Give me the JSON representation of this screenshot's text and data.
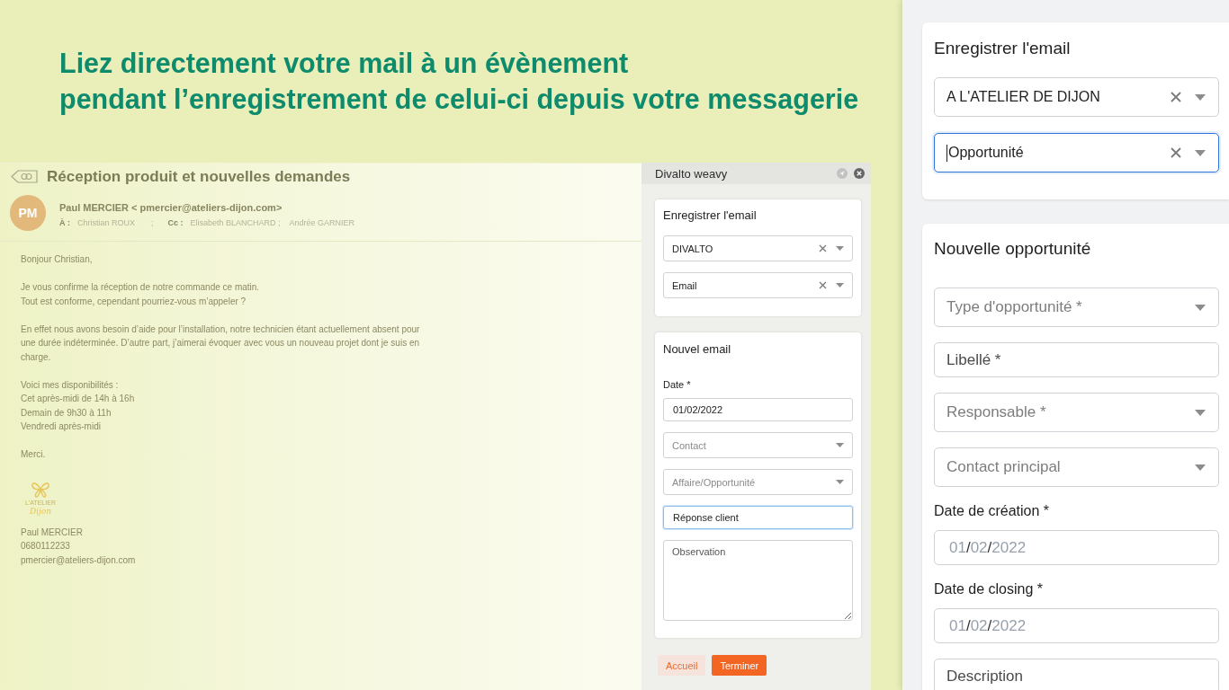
{
  "headline": [
    "Liez directement votre mail à un évènement",
    "pendant l’enregistrement de celui-ci depuis votre messagerie"
  ],
  "email": {
    "subject": "Réception produit et nouvelles demandes",
    "avatar_initials": "PM",
    "sender": "Paul MERCIER < pmercier@ateliers-dijon.com>",
    "recipients": [
      {
        "kind": "label",
        "text": "À :"
      },
      {
        "kind": "name",
        "text": "Christian ROUX"
      },
      {
        "kind": "separator",
        "text": ";"
      },
      {
        "kind": "label",
        "text": "Cc :"
      },
      {
        "kind": "name",
        "text": "Elisabeth BLANCHARD ;"
      },
      {
        "kind": "name",
        "text": "Andrée GARNIER"
      }
    ],
    "body": [
      [
        "Bonjour Christian,"
      ],
      [
        "Je vous confirme la réception de notre commande ce matin.",
        "Tout est conforme, cependant pourriez-vous m’appeler ?"
      ],
      [
        "En effet nous avons besoin d’aide pour l’installation, notre technicien étant actuellement absent pour une durée indéterminée. D’autre part, j’aimerai évoquer avec vous un nouveau projet dont je suis en charge."
      ],
      [
        "Voici mes disponibilités :",
        "Cet après-midi de 14h à 16h",
        "Demain de 9h30 à 11h",
        "Vendredi après-midi"
      ],
      [
        "Merci."
      ]
    ],
    "logo": {
      "name": "L'ATELIER",
      "script": "Dijon"
    },
    "signature": [
      "Paul MERCIER",
      "0680112233",
      "pmercier@ateliers-dijon.com"
    ]
  },
  "addin": {
    "title": "Divalto weavy",
    "cards": [
      {
        "title": "Enregistrer l'email",
        "fields": [
          {
            "kind": "select",
            "value": "DIVALTO",
            "focused": false
          },
          {
            "kind": "select",
            "value": "Email",
            "focused": false
          }
        ]
      },
      {
        "title": "Nouvel email",
        "fields": [
          {
            "kind": "input",
            "label": "Date *",
            "value": "01/02/2022",
            "focused": false
          },
          {
            "kind": "select",
            "placeholder": "Contact",
            "focused": false
          },
          {
            "kind": "select",
            "placeholder": "Affaire/Opportunité",
            "focused": false
          },
          {
            "kind": "input",
            "value": "Réponse client",
            "focused": true
          },
          {
            "kind": "textarea",
            "placeholder": "Observation",
            "focused": false
          }
        ]
      }
    ],
    "buttons": [
      {
        "kind": "secondary",
        "label": "Accueil"
      },
      {
        "kind": "primary",
        "label": "Terminer"
      }
    ]
  },
  "side_panel": {
    "cards": [
      {
        "title": "Enregistrer l'email",
        "fields": [
          {
            "kind": "select",
            "value": "A L'ATELIER DE DIJON",
            "focused": false
          },
          {
            "kind": "select",
            "value": "Opportunité",
            "focused": true
          }
        ]
      },
      {
        "title": "Nouvelle opportunité",
        "fields": [
          {
            "kind": "select",
            "placeholder": "Type d'opportunité *",
            "focused": false
          },
          {
            "kind": "input",
            "placeholder": "Libellé *",
            "focused": false
          },
          {
            "kind": "select",
            "placeholder": "Responsable *",
            "focused": false
          },
          {
            "kind": "select",
            "placeholder": "Contact principal",
            "focused": false
          },
          {
            "kind": "date",
            "label": "Date de création *",
            "parts": [
              "01",
              "/",
              "02",
              "/",
              "2022"
            ],
            "focused": false
          },
          {
            "kind": "date",
            "label": "Date de closing *",
            "parts": [
              "01",
              "/",
              "02",
              "/",
              "2022"
            ],
            "focused": false
          },
          {
            "kind": "input",
            "placeholder": "Description",
            "focused": false
          }
        ]
      }
    ]
  }
}
